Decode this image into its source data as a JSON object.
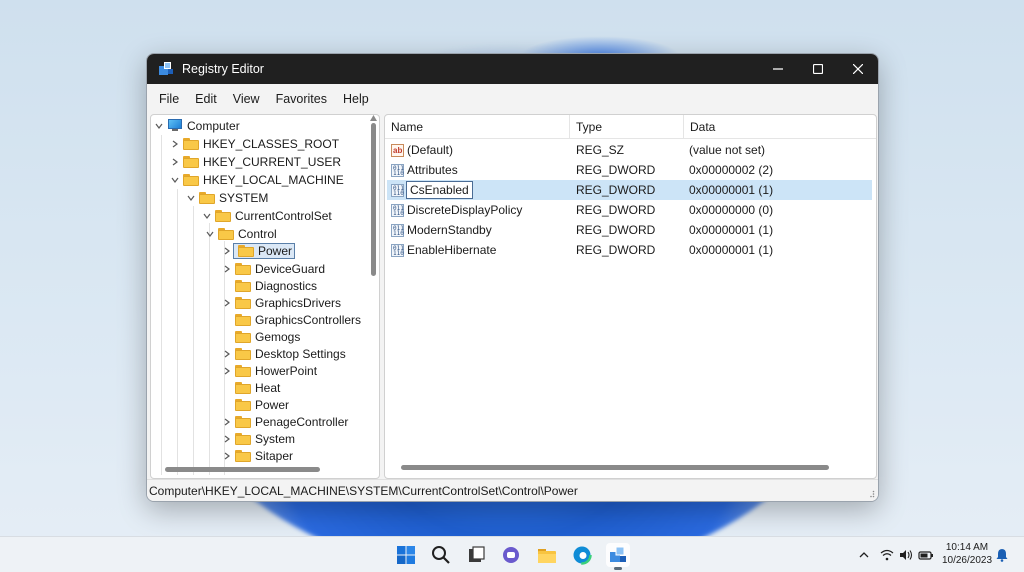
{
  "window": {
    "title": "Registry Editor",
    "controls": [
      "minimize",
      "maximize",
      "close"
    ]
  },
  "menu": [
    "File",
    "Edit",
    "View",
    "Favorites",
    "Help"
  ],
  "tree": {
    "items": [
      {
        "label": "Computer",
        "expanded": true,
        "icon": "computer-icon"
      },
      {
        "label": "HKEY_CLASSES_ROOT",
        "expanded": false,
        "icon": "folder-icon"
      },
      {
        "label": "HKEY_CURRENT_USER",
        "expanded": false,
        "icon": "folder-icon"
      },
      {
        "label": "HKEY_LOCAL_MACHINE",
        "expanded": true,
        "icon": "folder-icon"
      },
      {
        "label": "SYSTEM",
        "expanded": true,
        "icon": "folder-icon"
      },
      {
        "label": "CurrentControlSet",
        "expanded": true,
        "icon": "folder-icon"
      },
      {
        "label": "Control",
        "expanded": true,
        "icon": "folder-icon"
      },
      {
        "label": "Power",
        "selected": true,
        "icon": "folder-icon"
      },
      {
        "label": "DeviceGuard",
        "icon": "folder-icon"
      },
      {
        "label": "Diagnostics",
        "icon": "folder-icon"
      },
      {
        "label": "GraphicsDrivers",
        "icon": "folder-icon"
      },
      {
        "label": "GraphicsControllers",
        "icon": "folder-icon"
      },
      {
        "label": "Gemogs",
        "icon": "folder-icon"
      },
      {
        "label": "Desktop Settings",
        "icon": "folder-icon"
      },
      {
        "label": "HowerPoint",
        "icon": "folder-icon"
      },
      {
        "label": "Heat",
        "icon": "folder-icon"
      },
      {
        "label": "Power",
        "icon": "folder-icon"
      },
      {
        "label": "PenageController",
        "icon": "folder-icon"
      },
      {
        "label": "System",
        "icon": "folder-icon"
      },
      {
        "label": "Sitaper",
        "icon": "folder-icon"
      }
    ]
  },
  "values": {
    "columns": [
      "Name",
      "Type",
      "Data"
    ],
    "rows": [
      {
        "name": "(Default)",
        "type": "REG_SZ",
        "data": "(value not set)",
        "icon": "string-value-icon"
      },
      {
        "name": "Attributes",
        "type": "REG_DWORD",
        "data": "0x00000002 (2)",
        "icon": "binary-value-icon"
      },
      {
        "name": "CsEnabled",
        "type": "REG_DWORD",
        "data": "0x00000001 (1)",
        "icon": "binary-value-icon",
        "selected": true
      },
      {
        "name": "DiscreteDisplayPolicy",
        "type": "REG_DWORD",
        "data": "0x00000000 (0)",
        "icon": "binary-value-icon"
      },
      {
        "name": "ModernStandby",
        "type": "REG_DWORD",
        "data": "0x00000001 (1)",
        "icon": "binary-value-icon"
      },
      {
        "name": "EnableHibernate",
        "type": "REG_DWORD",
        "data": "0x00000001 (1)",
        "icon": "binary-value-icon"
      }
    ]
  },
  "statusbar": {
    "path": "Computer\\HKEY_LOCAL_MACHINE\\SYSTEM\\CurrentControlSet\\Control\\Power"
  },
  "taskbar": {
    "apps": [
      "start-icon",
      "search-icon",
      "task-view-icon",
      "chat-icon",
      "file-explorer-icon",
      "edge-icon",
      "registry-editor-icon"
    ],
    "time": "10:14 AM",
    "date": "10/26/2023"
  },
  "colors": {
    "titlebar": "#202020",
    "selection": "#cce4f7",
    "accent": "#0067c0"
  }
}
